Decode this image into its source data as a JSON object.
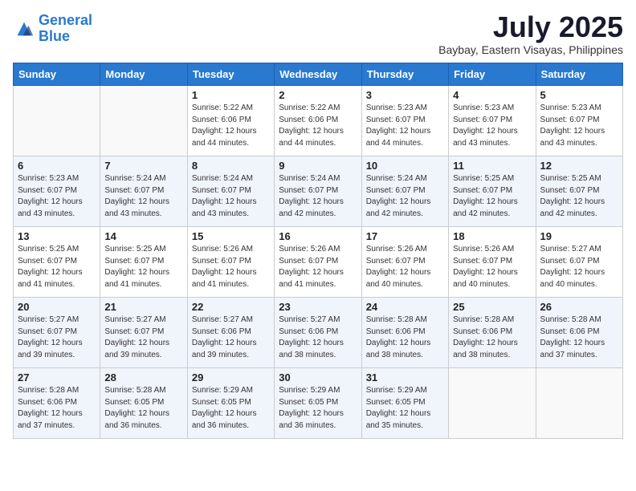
{
  "header": {
    "logo_line1": "General",
    "logo_line2": "Blue",
    "month": "July 2025",
    "location": "Baybay, Eastern Visayas, Philippines"
  },
  "weekdays": [
    "Sunday",
    "Monday",
    "Tuesday",
    "Wednesday",
    "Thursday",
    "Friday",
    "Saturday"
  ],
  "weeks": [
    [
      {
        "day": "",
        "sunrise": "",
        "sunset": "",
        "daylight": "",
        "empty": true
      },
      {
        "day": "",
        "sunrise": "",
        "sunset": "",
        "daylight": "",
        "empty": true
      },
      {
        "day": "1",
        "sunrise": "Sunrise: 5:22 AM",
        "sunset": "Sunset: 6:06 PM",
        "daylight": "Daylight: 12 hours and 44 minutes.",
        "empty": false
      },
      {
        "day": "2",
        "sunrise": "Sunrise: 5:22 AM",
        "sunset": "Sunset: 6:06 PM",
        "daylight": "Daylight: 12 hours and 44 minutes.",
        "empty": false
      },
      {
        "day": "3",
        "sunrise": "Sunrise: 5:23 AM",
        "sunset": "Sunset: 6:07 PM",
        "daylight": "Daylight: 12 hours and 44 minutes.",
        "empty": false
      },
      {
        "day": "4",
        "sunrise": "Sunrise: 5:23 AM",
        "sunset": "Sunset: 6:07 PM",
        "daylight": "Daylight: 12 hours and 43 minutes.",
        "empty": false
      },
      {
        "day": "5",
        "sunrise": "Sunrise: 5:23 AM",
        "sunset": "Sunset: 6:07 PM",
        "daylight": "Daylight: 12 hours and 43 minutes.",
        "empty": false
      }
    ],
    [
      {
        "day": "6",
        "sunrise": "Sunrise: 5:23 AM",
        "sunset": "Sunset: 6:07 PM",
        "daylight": "Daylight: 12 hours and 43 minutes.",
        "empty": false
      },
      {
        "day": "7",
        "sunrise": "Sunrise: 5:24 AM",
        "sunset": "Sunset: 6:07 PM",
        "daylight": "Daylight: 12 hours and 43 minutes.",
        "empty": false
      },
      {
        "day": "8",
        "sunrise": "Sunrise: 5:24 AM",
        "sunset": "Sunset: 6:07 PM",
        "daylight": "Daylight: 12 hours and 43 minutes.",
        "empty": false
      },
      {
        "day": "9",
        "sunrise": "Sunrise: 5:24 AM",
        "sunset": "Sunset: 6:07 PM",
        "daylight": "Daylight: 12 hours and 42 minutes.",
        "empty": false
      },
      {
        "day": "10",
        "sunrise": "Sunrise: 5:24 AM",
        "sunset": "Sunset: 6:07 PM",
        "daylight": "Daylight: 12 hours and 42 minutes.",
        "empty": false
      },
      {
        "day": "11",
        "sunrise": "Sunrise: 5:25 AM",
        "sunset": "Sunset: 6:07 PM",
        "daylight": "Daylight: 12 hours and 42 minutes.",
        "empty": false
      },
      {
        "day": "12",
        "sunrise": "Sunrise: 5:25 AM",
        "sunset": "Sunset: 6:07 PM",
        "daylight": "Daylight: 12 hours and 42 minutes.",
        "empty": false
      }
    ],
    [
      {
        "day": "13",
        "sunrise": "Sunrise: 5:25 AM",
        "sunset": "Sunset: 6:07 PM",
        "daylight": "Daylight: 12 hours and 41 minutes.",
        "empty": false
      },
      {
        "day": "14",
        "sunrise": "Sunrise: 5:25 AM",
        "sunset": "Sunset: 6:07 PM",
        "daylight": "Daylight: 12 hours and 41 minutes.",
        "empty": false
      },
      {
        "day": "15",
        "sunrise": "Sunrise: 5:26 AM",
        "sunset": "Sunset: 6:07 PM",
        "daylight": "Daylight: 12 hours and 41 minutes.",
        "empty": false
      },
      {
        "day": "16",
        "sunrise": "Sunrise: 5:26 AM",
        "sunset": "Sunset: 6:07 PM",
        "daylight": "Daylight: 12 hours and 41 minutes.",
        "empty": false
      },
      {
        "day": "17",
        "sunrise": "Sunrise: 5:26 AM",
        "sunset": "Sunset: 6:07 PM",
        "daylight": "Daylight: 12 hours and 40 minutes.",
        "empty": false
      },
      {
        "day": "18",
        "sunrise": "Sunrise: 5:26 AM",
        "sunset": "Sunset: 6:07 PM",
        "daylight": "Daylight: 12 hours and 40 minutes.",
        "empty": false
      },
      {
        "day": "19",
        "sunrise": "Sunrise: 5:27 AM",
        "sunset": "Sunset: 6:07 PM",
        "daylight": "Daylight: 12 hours and 40 minutes.",
        "empty": false
      }
    ],
    [
      {
        "day": "20",
        "sunrise": "Sunrise: 5:27 AM",
        "sunset": "Sunset: 6:07 PM",
        "daylight": "Daylight: 12 hours and 39 minutes.",
        "empty": false
      },
      {
        "day": "21",
        "sunrise": "Sunrise: 5:27 AM",
        "sunset": "Sunset: 6:07 PM",
        "daylight": "Daylight: 12 hours and 39 minutes.",
        "empty": false
      },
      {
        "day": "22",
        "sunrise": "Sunrise: 5:27 AM",
        "sunset": "Sunset: 6:06 PM",
        "daylight": "Daylight: 12 hours and 39 minutes.",
        "empty": false
      },
      {
        "day": "23",
        "sunrise": "Sunrise: 5:27 AM",
        "sunset": "Sunset: 6:06 PM",
        "daylight": "Daylight: 12 hours and 38 minutes.",
        "empty": false
      },
      {
        "day": "24",
        "sunrise": "Sunrise: 5:28 AM",
        "sunset": "Sunset: 6:06 PM",
        "daylight": "Daylight: 12 hours and 38 minutes.",
        "empty": false
      },
      {
        "day": "25",
        "sunrise": "Sunrise: 5:28 AM",
        "sunset": "Sunset: 6:06 PM",
        "daylight": "Daylight: 12 hours and 38 minutes.",
        "empty": false
      },
      {
        "day": "26",
        "sunrise": "Sunrise: 5:28 AM",
        "sunset": "Sunset: 6:06 PM",
        "daylight": "Daylight: 12 hours and 37 minutes.",
        "empty": false
      }
    ],
    [
      {
        "day": "27",
        "sunrise": "Sunrise: 5:28 AM",
        "sunset": "Sunset: 6:06 PM",
        "daylight": "Daylight: 12 hours and 37 minutes.",
        "empty": false
      },
      {
        "day": "28",
        "sunrise": "Sunrise: 5:28 AM",
        "sunset": "Sunset: 6:05 PM",
        "daylight": "Daylight: 12 hours and 36 minutes.",
        "empty": false
      },
      {
        "day": "29",
        "sunrise": "Sunrise: 5:29 AM",
        "sunset": "Sunset: 6:05 PM",
        "daylight": "Daylight: 12 hours and 36 minutes.",
        "empty": false
      },
      {
        "day": "30",
        "sunrise": "Sunrise: 5:29 AM",
        "sunset": "Sunset: 6:05 PM",
        "daylight": "Daylight: 12 hours and 36 minutes.",
        "empty": false
      },
      {
        "day": "31",
        "sunrise": "Sunrise: 5:29 AM",
        "sunset": "Sunset: 6:05 PM",
        "daylight": "Daylight: 12 hours and 35 minutes.",
        "empty": false
      },
      {
        "day": "",
        "sunrise": "",
        "sunset": "",
        "daylight": "",
        "empty": true
      },
      {
        "day": "",
        "sunrise": "",
        "sunset": "",
        "daylight": "",
        "empty": true
      }
    ]
  ]
}
